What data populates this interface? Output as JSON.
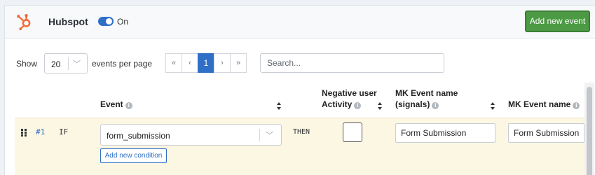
{
  "header": {
    "title": "Hubspot",
    "toggle_label": "On",
    "add_event_label": "Add new event",
    "logo_icon": "hubspot-logo",
    "accent_color": "#2f6fc7",
    "brand_color": "#f26b38",
    "add_button_color": "#4c9a43"
  },
  "controls": {
    "show_label": "Show",
    "per_page_value": "20",
    "events_label": "events per page",
    "pager": {
      "first": "«",
      "prev": "‹",
      "current": "1",
      "next": "›",
      "last": "»"
    },
    "search_placeholder": "Search..."
  },
  "table": {
    "columns": {
      "event": "Event",
      "negative_line1": "Negative user",
      "negative_line2": "Activity",
      "mk_signals_line1": "MK Event name",
      "mk_signals_line2": "(signals)",
      "mk_name": "MK Event name"
    },
    "rows": [
      {
        "num": "#1",
        "if_label": "IF",
        "event_value": "form_submission",
        "add_condition_label": "Add new condition",
        "then_label": "THEN",
        "negative_checked": false,
        "mk_signals_value": "Form Submission",
        "mk_name_value": "Form Submission"
      }
    ]
  }
}
